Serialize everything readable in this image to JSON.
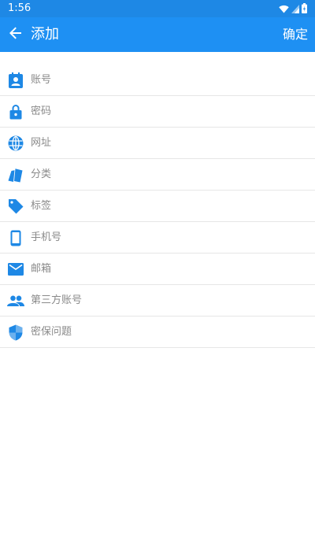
{
  "status_bar": {
    "time": "1:56",
    "icons": [
      "wifi-icon",
      "signal-icon",
      "battery-icon"
    ]
  },
  "app_bar": {
    "back_icon": "arrow-left-icon",
    "title": "添加",
    "confirm_label": "确定"
  },
  "colors": {
    "primary": "#1e90f3",
    "status_bar": "#1e88e5",
    "icon": "#1e88e5",
    "label": "#8a8a8a",
    "divider": "#e6e6e6"
  },
  "fields": [
    {
      "icon": "contact-card-icon",
      "label": "账号"
    },
    {
      "icon": "lock-icon",
      "label": "密码"
    },
    {
      "icon": "globe-icon",
      "label": "网址"
    },
    {
      "icon": "cards-icon",
      "label": "分类"
    },
    {
      "icon": "tag-icon",
      "label": "标签"
    },
    {
      "icon": "phone-icon",
      "label": "手机号"
    },
    {
      "icon": "mail-icon",
      "label": "邮箱"
    },
    {
      "icon": "people-icon",
      "label": "第三方账号"
    },
    {
      "icon": "shield-icon",
      "label": "密保问题"
    }
  ]
}
